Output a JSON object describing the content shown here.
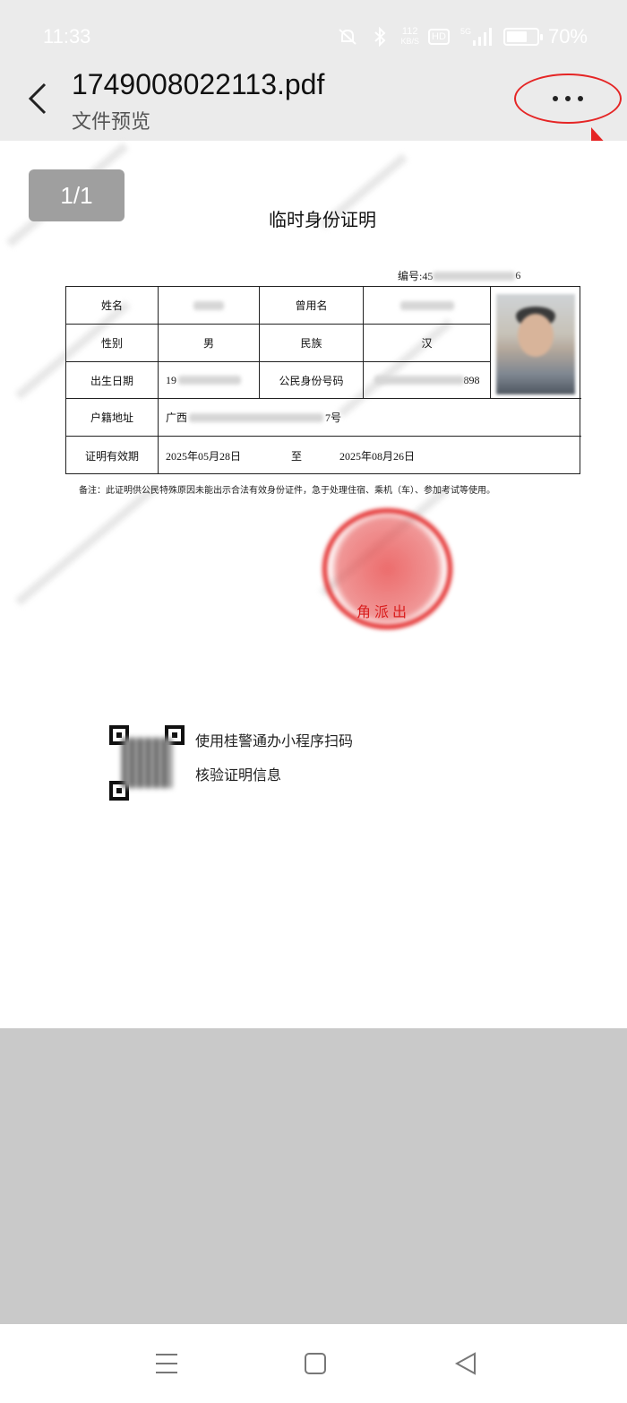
{
  "status_bar": {
    "time": "11:33",
    "net_speed_value": "112",
    "net_speed_unit": "KB/S",
    "hd_label": "HD",
    "network_label": "5G",
    "battery_percent": "70%",
    "battery_level": 0.7
  },
  "header": {
    "title": "1749008022113.pdf",
    "subtitle": "文件预览"
  },
  "document": {
    "page_indicator": "1/1",
    "title": "临时身份证明",
    "serial_prefix": "编号:45",
    "serial_suffix": "6",
    "table": {
      "name_label": "姓名",
      "former_name_label": "曾用名",
      "gender_label": "性别",
      "gender_value": "男",
      "ethnicity_label": "民族",
      "ethnicity_value": "汉",
      "birth_label": "出生日期",
      "birth_value_prefix": "19",
      "id_label": "公民身份号码",
      "id_value_suffix": "898",
      "address_label": "户籍地址",
      "address_prefix": "广西",
      "address_suffix": "7号",
      "validity_label": "证明有效期",
      "validity_from": "2025年05月28日",
      "validity_to_label": "至",
      "validity_to": "2025年08月26日"
    },
    "remark": "备注：此证明供公民特殊原因未能出示合法有效身份证件，急于处理住宿、乘机（车）、参加考试等使用。",
    "stamp_text": "角派出",
    "qr_line1": "使用桂警通办小程序扫码",
    "qr_line2": "核验证明信息"
  },
  "colors": {
    "header_bg": "#ebebeb",
    "highlight_red": "#e52525",
    "stamp_red": "#e22424",
    "lower_gray": "#c9c9c9"
  },
  "icons": {
    "back": "chevron-left-icon",
    "more": "more-horizontal-icon",
    "nav_menu": "menu-icon",
    "nav_home": "square-home-icon",
    "nav_back": "triangle-back-icon"
  }
}
